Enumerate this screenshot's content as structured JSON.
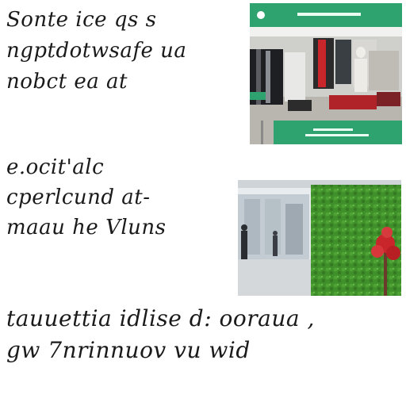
{
  "blocks": [
    {
      "lines": [
        "Sonte ice qs s",
        "ngptdotwsafe ua",
        "nobct ea at"
      ]
    },
    {
      "lines": [
        "e.ocit'alc",
        "cperlcund at-",
        "maau he Vluns"
      ]
    },
    {
      "lines": [
        "tauuettia idlise d: ooraua ,",
        "gw 7nrinnuov vu wid"
      ]
    }
  ],
  "images": [
    {
      "kind": "photo",
      "subject": "clothing store interior"
    },
    {
      "kind": "photo",
      "subject": "mall corridor with green wall and red tree"
    }
  ],
  "colors": {
    "text": "#1a1a1a",
    "banner_green": "#2ea36f",
    "wall_green": "#3f8f2a",
    "tree_red": "#c8262a"
  }
}
